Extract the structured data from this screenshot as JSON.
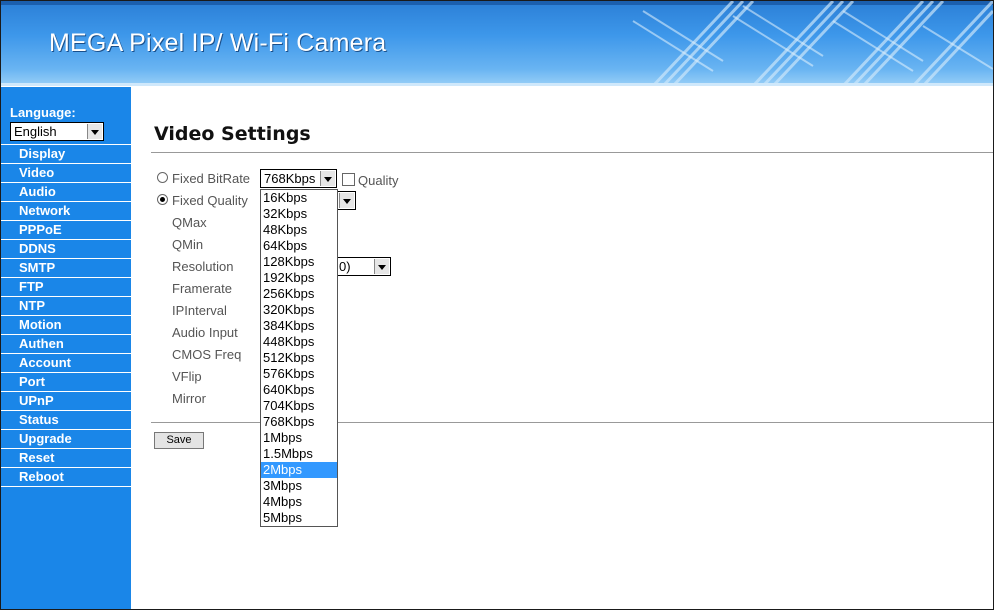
{
  "banner": {
    "title": "MEGA Pixel IP/ Wi-Fi Camera"
  },
  "sidebar": {
    "language_label": "Language:",
    "language_value": "English",
    "items": [
      "Display",
      "Video",
      "Audio",
      "Network",
      "PPPoE",
      "DDNS",
      "SMTP",
      "FTP",
      "NTP",
      "Motion",
      "Authen",
      "Account",
      "Port",
      "UPnP",
      "Status",
      "Upgrade",
      "Reset",
      "Reboot"
    ]
  },
  "main": {
    "title": "Video Settings",
    "fixed_bitrate_label": "Fixed BitRate",
    "bitrate_value": "768Kbps",
    "quality_checkbox_label": "Quality",
    "fixed_quality_label": "Fixed Quality",
    "fields": [
      "QMax",
      "QMin",
      "Resolution",
      "Framerate",
      "IPInterval",
      "Audio Input",
      "CMOS Freq",
      "VFlip",
      "Mirror"
    ],
    "resolution_partial_value": "0)",
    "save_label": "Save"
  },
  "bitrate_dropdown": {
    "options": [
      "16Kbps",
      "32Kbps",
      "48Kbps",
      "64Kbps",
      "128Kbps",
      "192Kbps",
      "256Kbps",
      "320Kbps",
      "384Kbps",
      "448Kbps",
      "512Kbps",
      "576Kbps",
      "640Kbps",
      "704Kbps",
      "768Kbps",
      "1Mbps",
      "1.5Mbps",
      "2Mbps",
      "3Mbps",
      "4Mbps",
      "5Mbps"
    ],
    "highlighted": "2Mbps"
  },
  "colors": {
    "sidebar": "#1a86e8",
    "highlight": "#3399ff"
  }
}
